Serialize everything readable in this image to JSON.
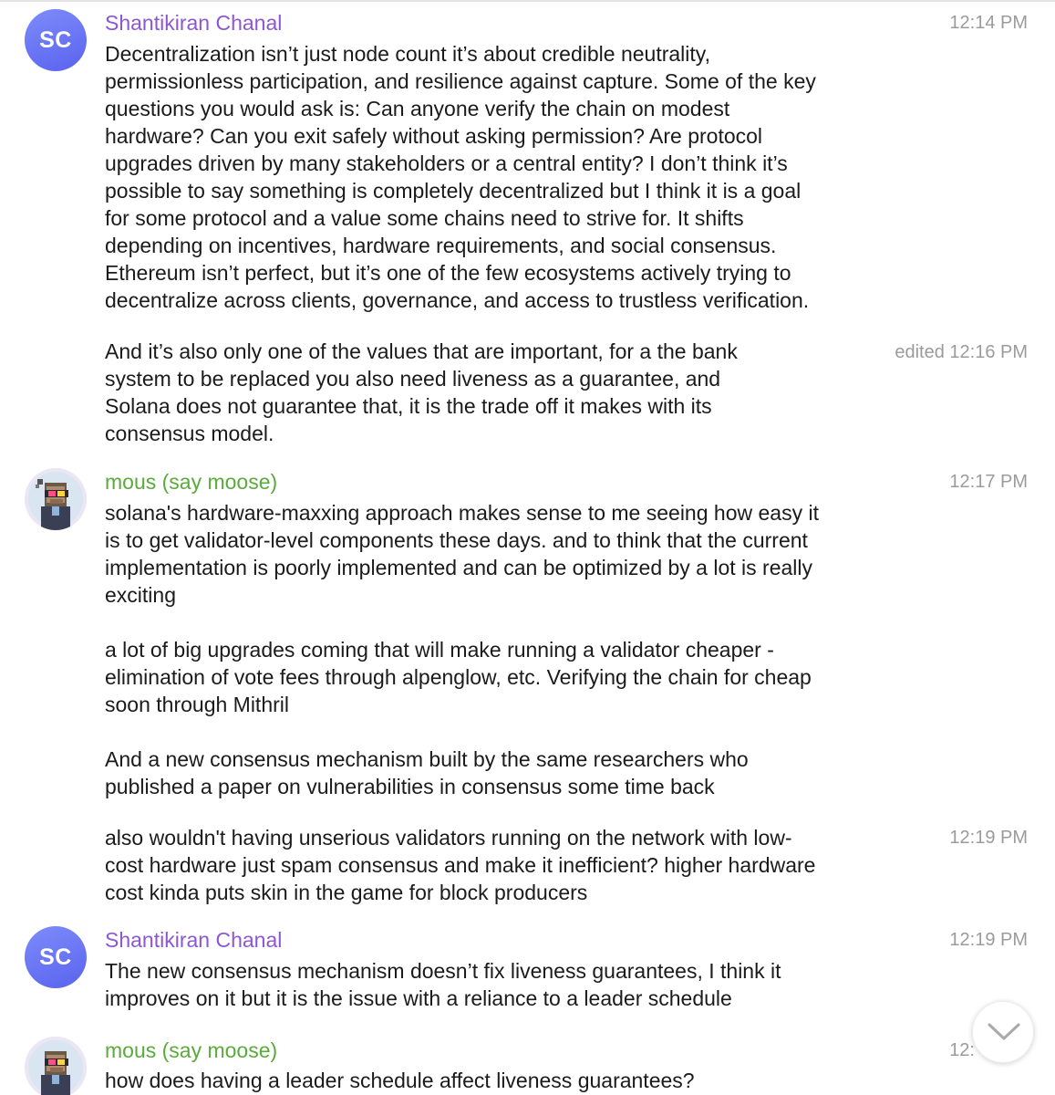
{
  "messages": [
    {
      "sender": "Shantikiran Chanal",
      "avatar_initials": "SC",
      "time": "12:14 PM",
      "text": "Decentralization isn’t just node count it’s about credible neutrality,\npermissionless participation, and resilience against capture. Some of the key\nquestions you would ask is: Can anyone verify the chain on modest\nhardware? Can you exit safely without asking permission? Are protocol\nupgrades driven by many stakeholders or a central entity? I don’t think it’s\npossible to say something is completely decentralized but I think it is a goal\nfor some protocol and a value some chains need to strive for. It shifts\ndepending on incentives, hardware requirements, and social consensus.\nEthereum isn’t perfect, but it’s one of the few ecosystems actively trying to\ndecentralize across clients, governance, and access to trustless verification."
    },
    {
      "time": "edited 12:16 PM",
      "text": "And it’s also only one of the values that are important, for a the bank\nsystem to be replaced you also need liveness as a guarantee, and\nSolana does not guarantee that, it is the trade off it makes with its\nconsensus model."
    },
    {
      "sender": "mous (say moose)",
      "time": "12:17 PM",
      "text": "solana's hardware-maxxing approach makes sense to me seeing how easy it\nis to get validator-level components these days. and to think that the current\nimplementation is poorly implemented and can be optimized by a lot is really\nexciting\n\na lot of big upgrades coming that will make running a validator cheaper -\nelimination of vote fees through alpenglow, etc. Verifying the chain for cheap\nsoon through Mithril\n\nAnd a new consensus mechanism built by the same researchers who\npublished a paper on vulnerabilities in consensus some time back"
    },
    {
      "time": "12:19 PM",
      "text": "also wouldn't having unserious validators running on the network with low-\ncost hardware just spam consensus and make it inefficient? higher hardware\ncost kinda puts skin in the game for block producers"
    },
    {
      "sender": "Shantikiran Chanal",
      "avatar_initials": "SC",
      "time": "12:19 PM",
      "text": "The new consensus mechanism doesn’t fix liveness guarantees, I think it\nimproves on it but it is the issue with a reliance to a leader schedule"
    },
    {
      "sender": "mous (say moose)",
      "time": "12:",
      "text": "how does having a leader schedule affect liveness guarantees?"
    }
  ],
  "colors": {
    "sc_name": "#8d57d4",
    "mous_name": "#5aaa3c",
    "timestamp": "#9b9b9b",
    "avatar_sc": "#6a74f3"
  },
  "icons": {
    "scroll_button": "chevron-down-icon"
  }
}
